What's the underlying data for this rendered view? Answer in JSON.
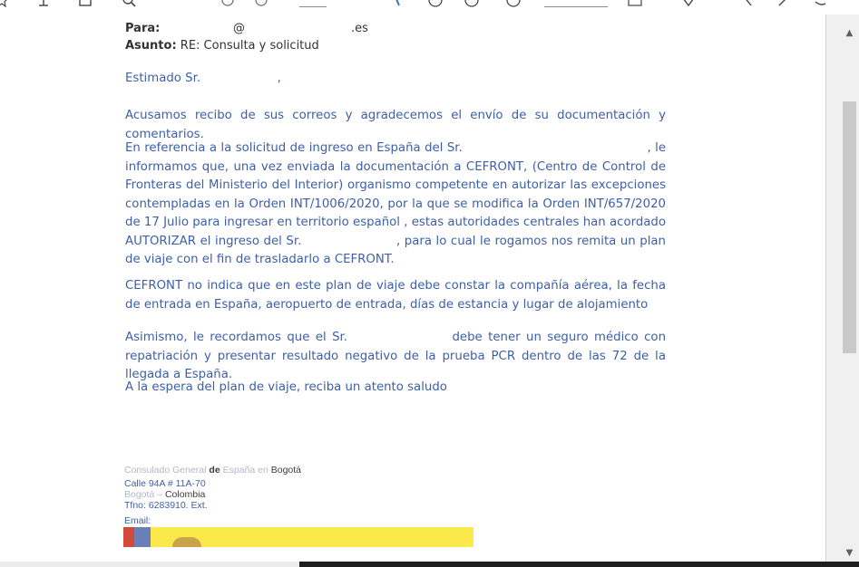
{
  "email": {
    "to_label": "Para:",
    "to_at": "@",
    "to_domain": ".es",
    "subject_label": "Asunto:",
    "subject": "RE: Consulta y solicitud"
  },
  "letter": {
    "greeting": "Estimado Sr.                    ,",
    "paragraphs": [
      "Acusamos recibo de sus correos y agradecemos el envío de su documentación y comentarios.",
      "En referencia a la solicitud de ingreso en España del Sr.                                              , le informamos que, una vez enviada la documentación a CEFRONT, (Centro de Control de Fronteras del Ministerio del Interior) organismo competente en autorizar las excepciones contempladas en la Orden INT/1006/2020, por la que se modifica la Orden INT/657/2020 de 17 Julio para ingresar en territorio español , estas autoridades centrales han acordado AUTORIZAR el ingreso del Sr.                       , para lo cual le rogamos nos remita un plan de viaje con el fin de trasladarlo a CEFRONT.",
      "CEFRONT no indica que en este plan de viaje debe constar la compañía aérea, la fecha de entrada en España, aeropuerto de entrada, días de estancia y lugar de alojamiento",
      "Asimismo, le recordamos que el Sr.                  debe tener un seguro médico con repatriación y presentar resultado negativo de la prueba PCR dentro de las 72 de la llegada a España.",
      "A la espera del plan de viaje, reciba un atento saludo"
    ]
  },
  "signature": {
    "line1_a": "Consulado General ",
    "line1_b": "de",
    "line1_c": " España ",
    "line1_d": "en",
    "line1_e": " Bogotá",
    "line2": "Calle 94A # 11A-70",
    "line3_a": "Bogotá – ",
    "line3_b": "Colombia",
    "line4": "Tfno: 6283910. Ext.",
    "line5": "Email:"
  },
  "colors": {
    "body_text": "#3d5fa8",
    "header_text": "#333333",
    "banner_yellow": "#fbe84a"
  }
}
